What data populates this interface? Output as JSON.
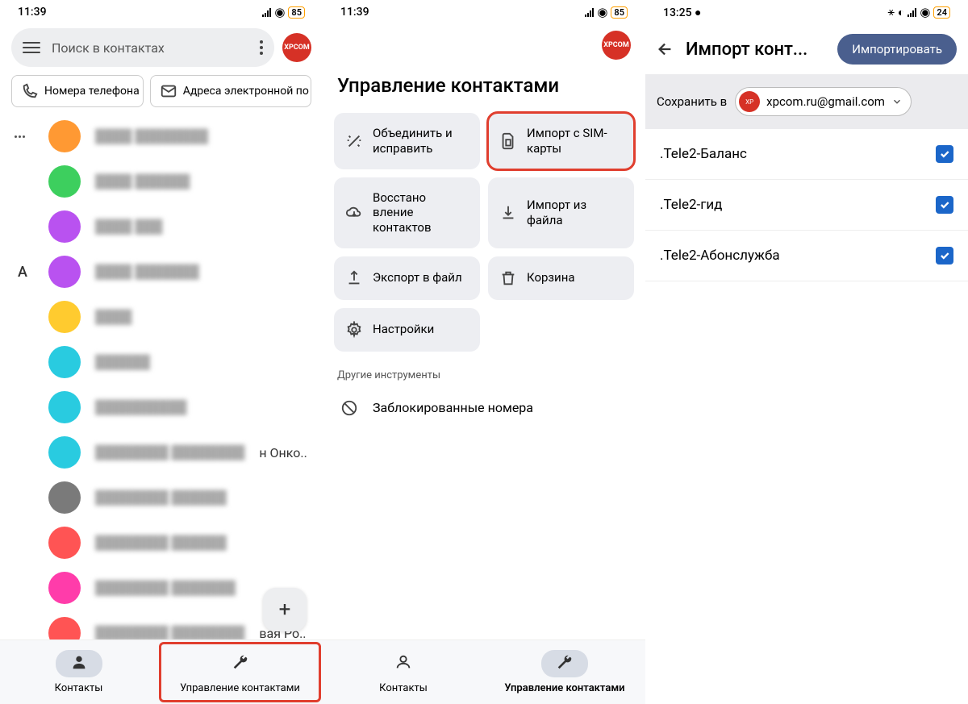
{
  "s1": {
    "time": "11:39",
    "battery": "85",
    "search_placeholder": "Поиск в контактах",
    "chip_phone": "Номера телефона",
    "chip_email": "Адреса электронной по",
    "letter_a": "А",
    "contacts": [
      {
        "color": "#ff9933"
      },
      {
        "color": "#3dcf5e"
      },
      {
        "color": "#b952f0"
      },
      {
        "color": "#b952f0"
      },
      {
        "color": "#ffcb2f"
      },
      {
        "color": "#29cbe0"
      },
      {
        "color": "#29cbe0"
      },
      {
        "color": "#29cbe0",
        "suffix": "н Онко.."
      },
      {
        "color": "#7a7a7a"
      },
      {
        "color": "#ff5454"
      },
      {
        "color": "#ff3caa"
      },
      {
        "color": "#ff5454",
        "suffix": "вая Ро.."
      }
    ],
    "nav_contacts": "Контакты",
    "nav_manage": "Управление контактами"
  },
  "s2": {
    "time": "11:39",
    "battery": "85",
    "title": "Управление контактами",
    "tiles": {
      "merge": "Объединить и исправить",
      "sim": "Импорт с SIM-карты",
      "restore": "Восстано вление контактов",
      "file_import": "Импорт из файла",
      "file_export": "Экспорт в файл",
      "trash": "Корзина",
      "settings": "Настройки"
    },
    "other_tools": "Другие инструменты",
    "blocked": "Заблокированные номера",
    "nav_contacts": "Контакты",
    "nav_manage": "Управление контактами"
  },
  "s3": {
    "time": "13:25",
    "battery": "24",
    "title": "Импорт конт...",
    "import_btn": "Импортировать",
    "save_to": "Сохранить в",
    "account": "xpcom.ru@gmail.com",
    "items": [
      ".Tele2-Баланс",
      ".Tele2-гид",
      ".Tele2-Абонслужба"
    ]
  }
}
